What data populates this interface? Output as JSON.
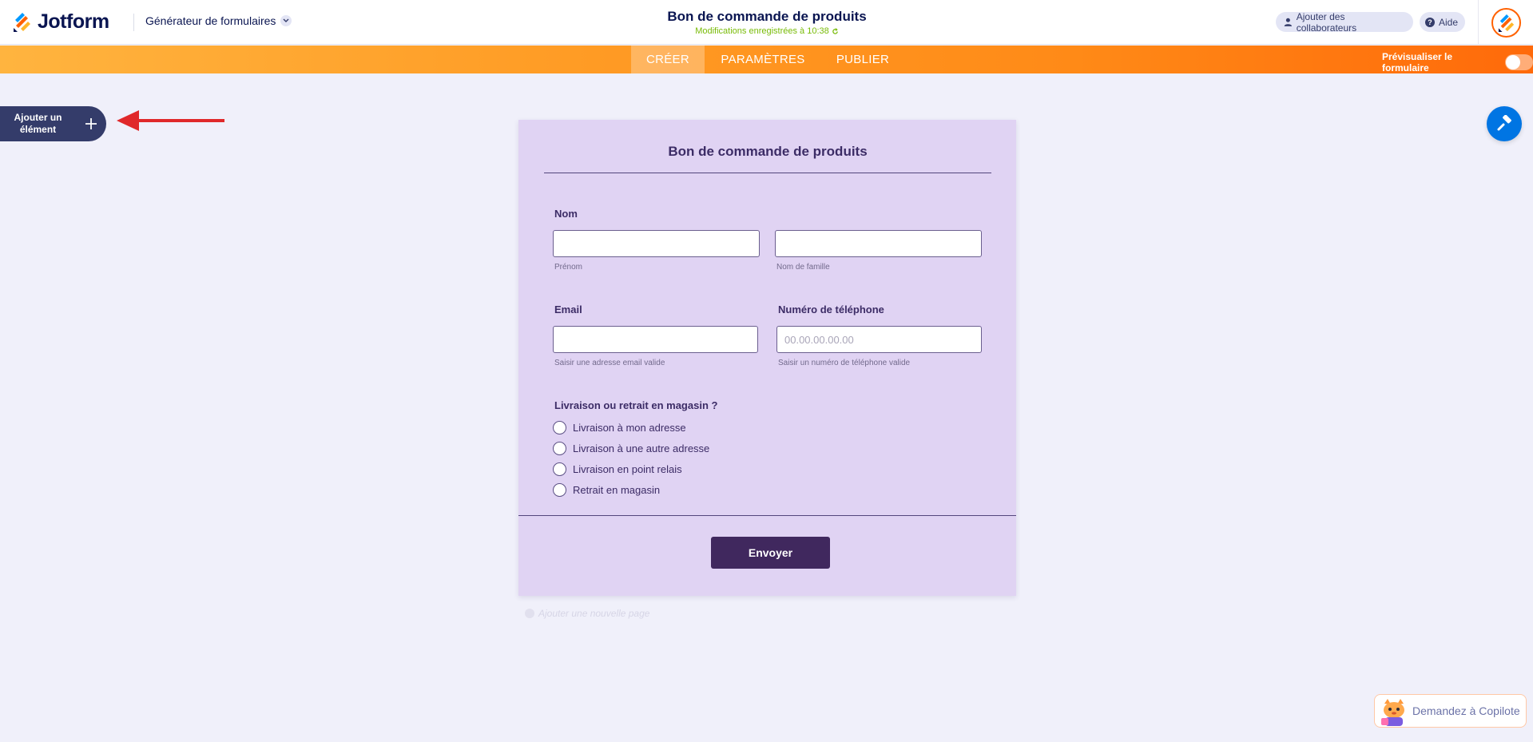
{
  "header": {
    "brand": "Jotform",
    "builder_label": "Générateur de formulaires",
    "form_title": "Bon de commande de produits",
    "save_status": "Modifications enregistrées à 10:38",
    "collaborators_label": "Ajouter des collaborateurs",
    "help_label": "Aide"
  },
  "nav": {
    "tabs": [
      {
        "label": "CRÉER",
        "active": true
      },
      {
        "label": "PARAMÈTRES",
        "active": false
      },
      {
        "label": "PUBLIER",
        "active": false
      }
    ],
    "preview_label": "Prévisualiser le formulaire",
    "preview_enabled": false
  },
  "sidebar": {
    "add_element_line1": "Ajouter un",
    "add_element_line2": "élément"
  },
  "form": {
    "title": "Bon de commande de produits",
    "name": {
      "label": "Nom",
      "first_sublabel": "Prénom",
      "last_sublabel": "Nom de famille",
      "first_value": "",
      "last_value": ""
    },
    "email": {
      "label": "Email",
      "value": "",
      "sublabel": "Saisir une adresse email valide"
    },
    "phone": {
      "label": "Numéro de téléphone",
      "placeholder": "00.00.00.00.00",
      "sublabel": "Saisir un numéro de téléphone valide"
    },
    "delivery": {
      "label": "Livraison ou retrait en magasin ?",
      "options": [
        "Livraison à mon adresse",
        "Livraison à une autre adresse",
        "Livraison en point relais",
        "Retrait en magasin"
      ]
    },
    "submit_label": "Envoyer",
    "add_page_label": "Ajouter une nouvelle page"
  },
  "copilot": {
    "label": "Demandez à Copilote"
  },
  "colors": {
    "brand_navy": "#0a1551",
    "accent_orange": "#ff6100",
    "form_background": "#e0d3f3",
    "submit_button": "#40285e",
    "save_status_green": "#78bb07",
    "designer_blue": "#0075e3"
  },
  "icons": {
    "brand": "jotform-logo-icon",
    "builder_chevron": "chevron-down-icon",
    "save_refresh": "refresh-icon",
    "collaborators": "user-icon",
    "help": "question-icon",
    "add_element": "plus-icon",
    "designer": "paint-roller-icon",
    "arrow_annotation": "red-arrow-icon"
  }
}
